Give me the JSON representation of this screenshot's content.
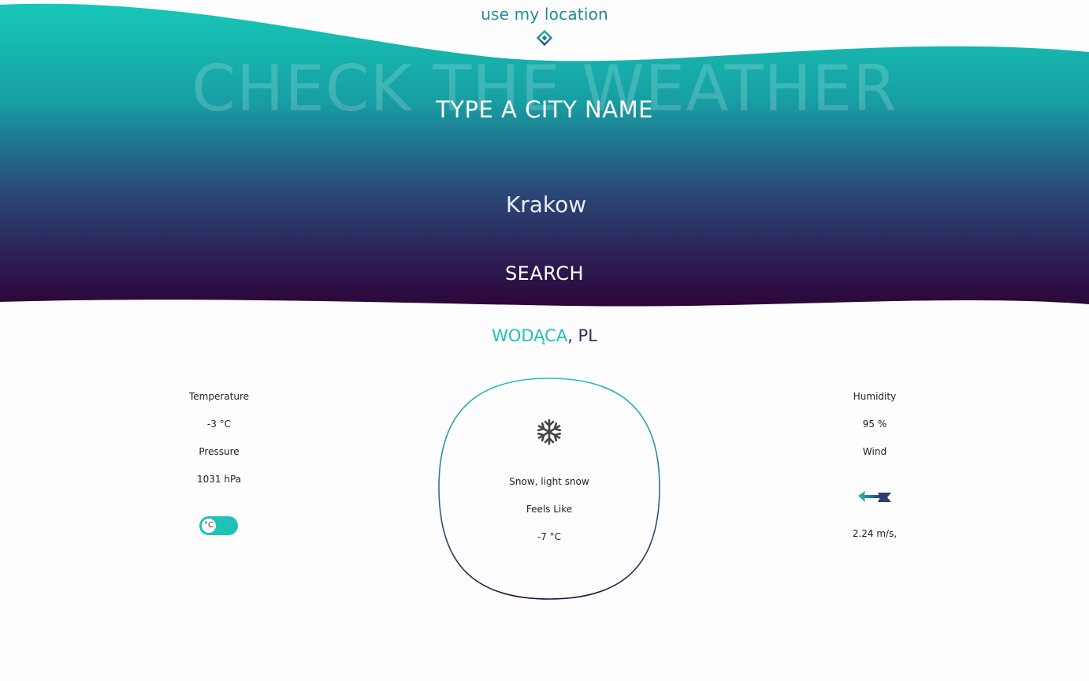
{
  "header": {
    "use_location_label": "use my location",
    "location_icon": "diamond-icon",
    "background_title": "CHECK THE WEATHER",
    "prompt": "TYPE A CITY NAME",
    "city_input_value": "Krakow",
    "search_label": "SEARCH"
  },
  "result": {
    "city": "WODĄCA",
    "country": ", PL",
    "condition_icon": "snowflake-icon",
    "description": "Snow, light snow",
    "feels_like_label": "Feels Like",
    "feels_like_value": "-7 °C",
    "temperature_label": "Temperature",
    "temperature_value": "-3 °C",
    "pressure_label": "Pressure",
    "pressure_value": "1031 hPa",
    "humidity_label": "Humidity",
    "humidity_value": "95 %",
    "wind_label": "Wind",
    "wind_icon": "wind-arrow-icon",
    "wind_value": "2.24 m/s,",
    "unit_toggle_label": "°C"
  },
  "colors": {
    "teal": "#1fc2b6",
    "mid_blue": "#2b4d7a",
    "deep_purple": "#2e0a3c",
    "text": "#222222"
  }
}
